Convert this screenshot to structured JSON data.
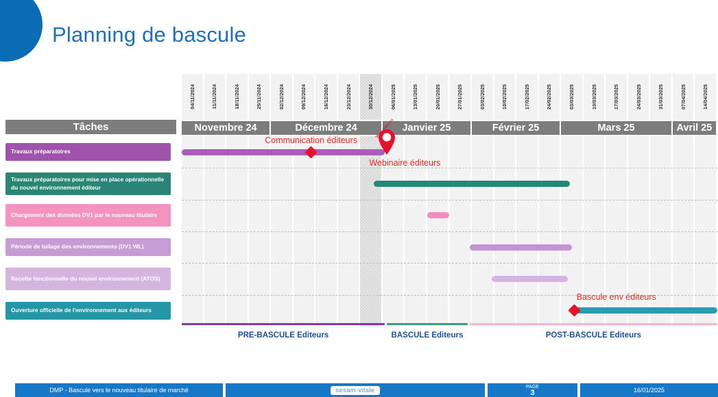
{
  "slide": {
    "title": "Planning de bascule",
    "tasks_header": "Tâches",
    "pin_text": "Vous êtes ici"
  },
  "colors": {
    "title_blue": "#1f6fbf",
    "header_gray": "#7d7d7d",
    "milestone_red": "#e8112d",
    "phase_blue": "#1a4f9c",
    "footer_blue": "#1878c8"
  },
  "chart_data": {
    "type": "bar",
    "title": "Planning de bascule",
    "xlabel": "",
    "ylabel": "",
    "weeks": [
      "04/11/2024",
      "11/11/2024",
      "18/11/2024",
      "25/11/2024",
      "02/12/2024",
      "09/12/2024",
      "16/12/2024",
      "23/12/2024",
      "30/12/2024",
      "06/01/2025",
      "13/01/2025",
      "20/01/2025",
      "27/01/2025",
      "03/02/2025",
      "10/02/2025",
      "17/02/2025",
      "24/02/2025",
      "03/03/2025",
      "10/03/2025",
      "17/03/2025",
      "24/03/2025",
      "31/03/2025",
      "07/04/2025",
      "14/04/2025"
    ],
    "highlight_week": "30/12/2024",
    "months": [
      {
        "label": "Novembre 24",
        "span": 4
      },
      {
        "label": "Décembre 24",
        "span": 5
      },
      {
        "label": "Janvier 25",
        "span": 4
      },
      {
        "label": "Février 25",
        "span": 4
      },
      {
        "label": "Mars 25",
        "span": 5
      },
      {
        "label": "Avril 25",
        "span": 2
      }
    ],
    "tasks": [
      {
        "label": "Travaux préparatoires",
        "color": "#a053ab",
        "bar_color": "#ab5cba",
        "start_week": 0,
        "end_week": 9.1
      },
      {
        "label": "Travaux préparatoires pour mise en place opérationnelle du nouvel environnement éditeur",
        "color": "#2a8577",
        "bar_color": "#1f8a76",
        "start_week": 8.6,
        "end_week": 17.4
      },
      {
        "label": "Chargement des données DV1 par le nouveau titulaire",
        "color": "#f493bf",
        "bar_color": "#f58cc0",
        "start_week": 11.0,
        "end_week": 12.0
      },
      {
        "label": "Période de tuilage des environnements (DV1 WL)",
        "color": "#c79bd4",
        "bar_color": "#c393d4",
        "start_week": 12.9,
        "end_week": 17.5
      },
      {
        "label": "Recette fonctionnelle du nouvel environnement (ATOS)",
        "color": "#d6b4e0",
        "bar_color": "#d5b3e3",
        "start_week": 13.9,
        "end_week": 17.3
      },
      {
        "label": "Ouverture officielle de l'environnement aux éditeurs",
        "color": "#2596a6",
        "bar_color": "#2a9cad",
        "start_week": 17.6,
        "end_week": 24.0
      }
    ],
    "milestones": [
      {
        "label": "Communication éditeurs",
        "week": 5.8,
        "row": 0
      },
      {
        "label": "Webinaire éditeurs",
        "week": 9.2,
        "row": 0,
        "marker": "pin"
      },
      {
        "label": "Bascule env éditeurs",
        "week": 17.6,
        "row": 5
      }
    ],
    "phases": [
      {
        "label": "PRE-BASCULE Editeurs",
        "color": "#7e3d9e",
        "start_week": 0,
        "end_week": 9.1
      },
      {
        "label": "BASCULE Editeurs",
        "color": "#3f9a7f",
        "start_week": 9.2,
        "end_week": 12.8
      },
      {
        "label": "POST-BASCULE Editeurs",
        "color": "#f3b8d8",
        "start_week": 12.9,
        "end_week": 24.0
      }
    ]
  },
  "footer": {
    "doc_title": "DMP - Bascule vers le nouveau titulaire de marché",
    "logo": "sesam-vitale",
    "page_word": "PAGE",
    "page_number": "3",
    "date": "16/01/2025"
  }
}
